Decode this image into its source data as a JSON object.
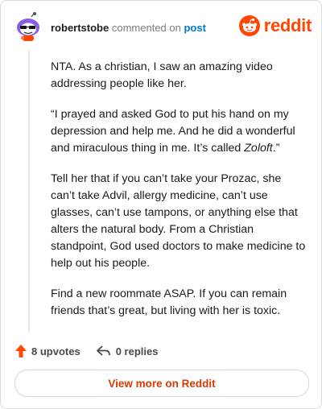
{
  "comment": {
    "author": "robertstobe",
    "action": "commented on",
    "link_text": "post"
  },
  "brand": {
    "name": "reddit",
    "icon": "reddit-logo-icon",
    "color": "#ff4500"
  },
  "body": {
    "p1": "NTA. As a christian, I saw an amazing video addressing people like her.",
    "p2_text": "“I prayed and asked God to put his hand on my depression and help me. And he did a wonderful and miraculous thing in me. It’s called ",
    "p2_em": "Zoloft",
    "p2_end": ".”",
    "p3": "Tell her that if you can’t take your Prozac, she can’t take Advil, allergy medicine, can’t use glasses, can’t use tampons, or anything else that alters the natural body. From a Christian standpoint, God used doctors to make medicine to help out his people.",
    "p4": "Find a new roommate ASAP. If you can remain friends that’s great, but living with her is toxic."
  },
  "actions": {
    "upvotes": "8 upvotes",
    "upvote_icon": "upvote-arrow-icon",
    "replies": "0 replies",
    "reply_icon": "reply-arrow-icon"
  },
  "view_more": "View more on Reddit",
  "colors": {
    "accent": "#ff4500",
    "link": "#0079d3",
    "cta": "#d93a00"
  }
}
